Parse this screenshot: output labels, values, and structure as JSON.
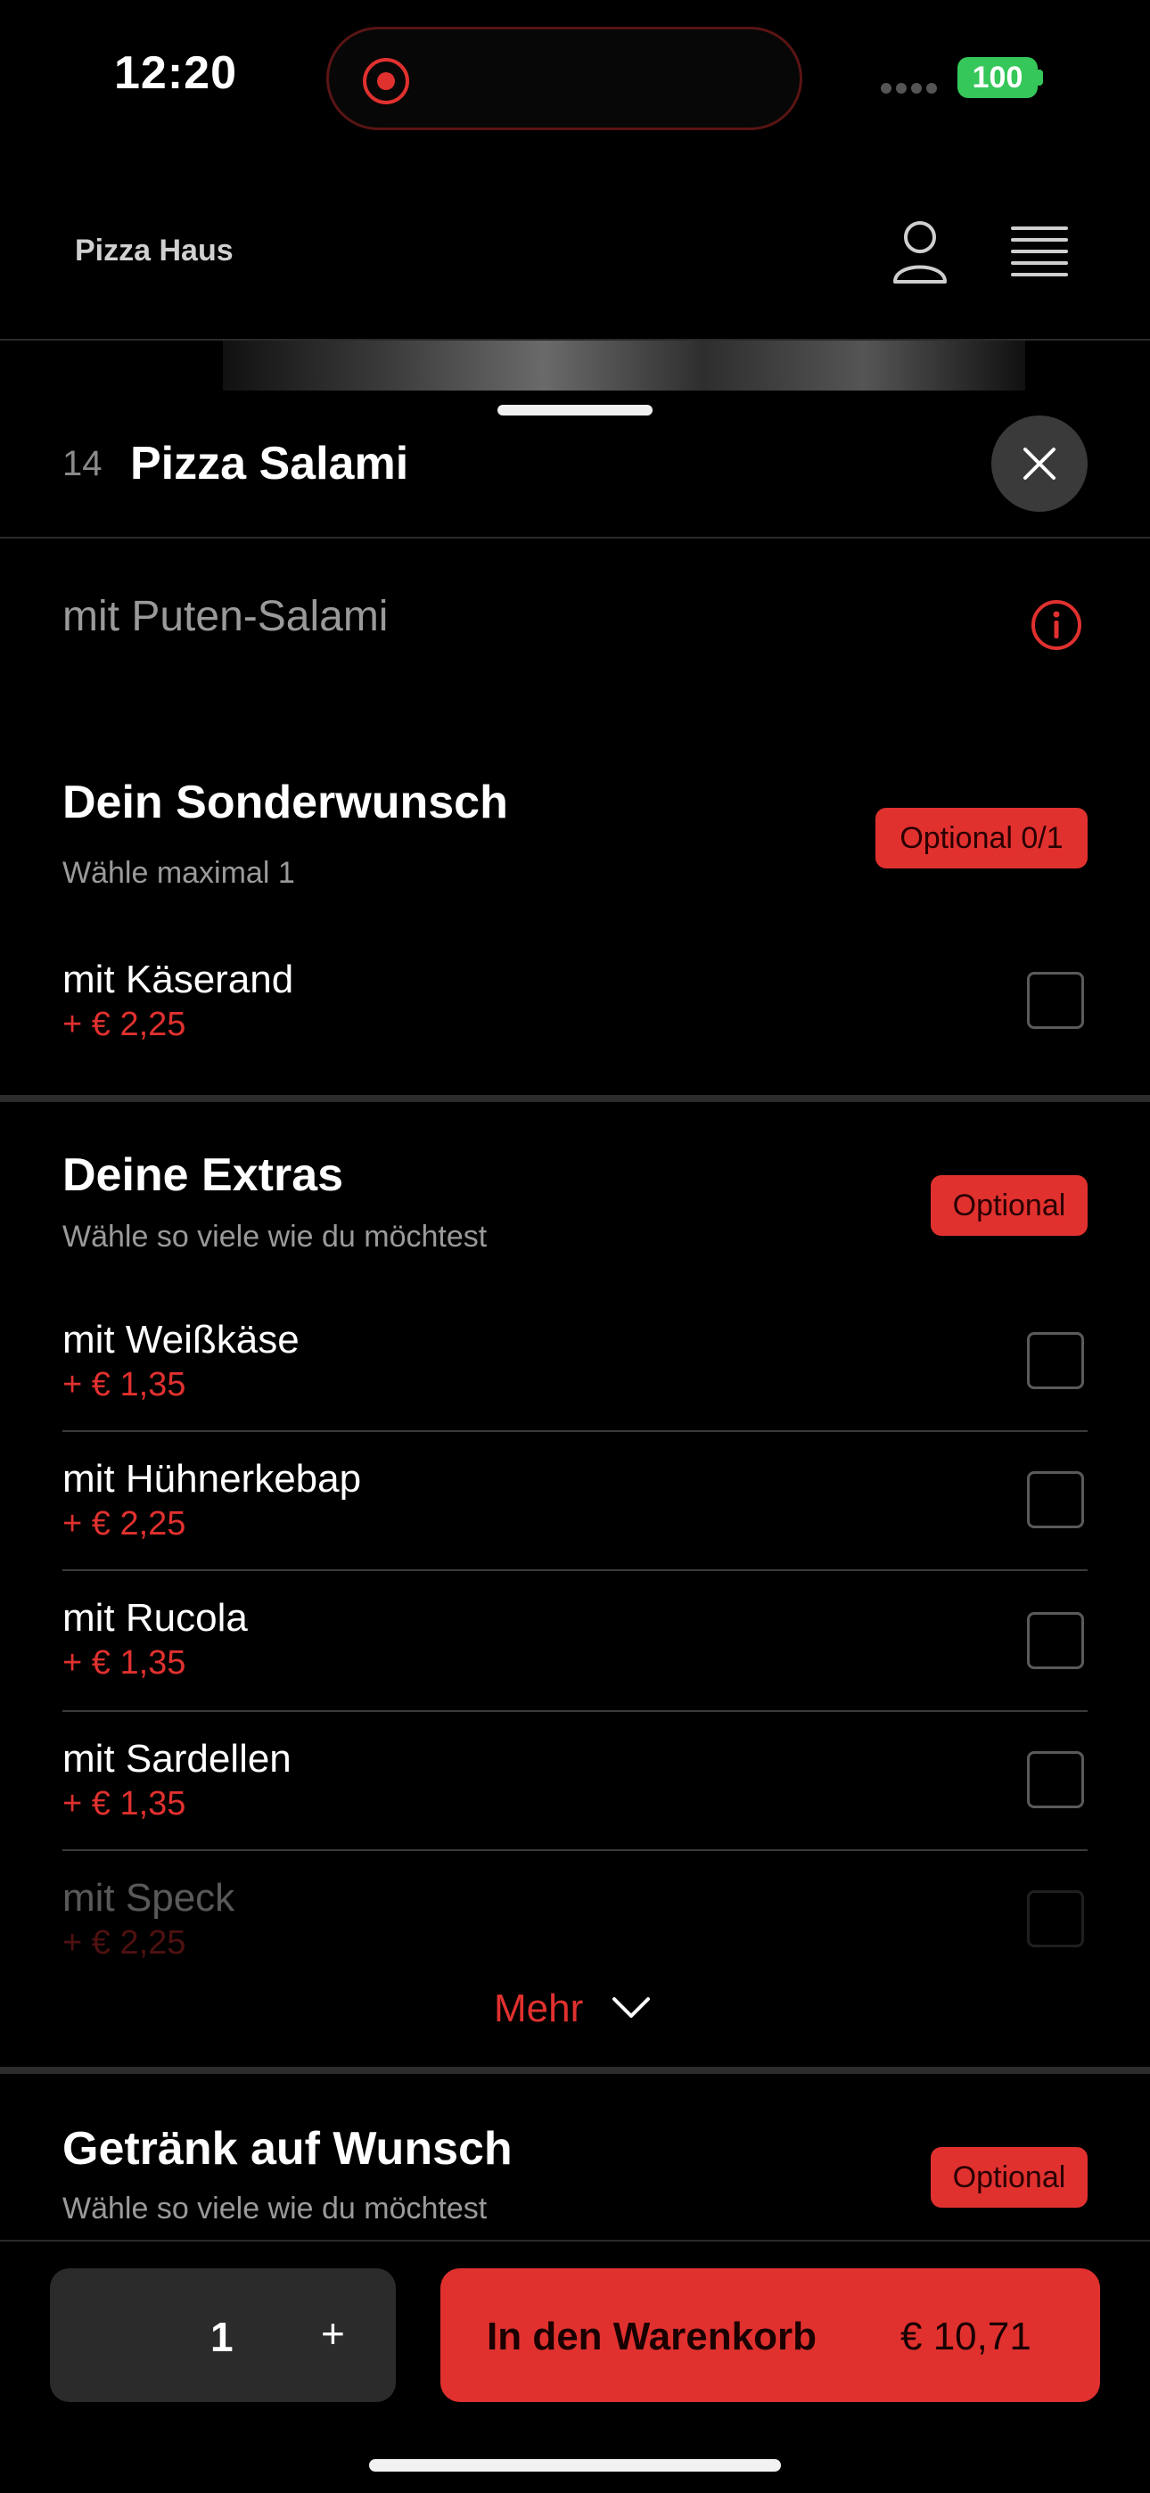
{
  "status_bar": {
    "time": "12:20",
    "battery": "100"
  },
  "header": {
    "brand": "Pizza Haus",
    "user_icon": "user-icon",
    "menu_icon": "hamburger-menu-icon"
  },
  "item": {
    "number": "14",
    "title": "Pizza Salami",
    "description": "mit Puten-Salami"
  },
  "sections": {
    "sonderwunsch": {
      "title": "Dein Sonderwunsch",
      "subtitle": "Wähle maximal 1",
      "badge": "Optional 0/1",
      "options": [
        {
          "name": "mit Käserand",
          "price": "+ € 2,25"
        }
      ]
    },
    "extras": {
      "title": "Deine Extras",
      "subtitle": "Wähle so viele wie du möchtest",
      "badge": "Optional",
      "options": [
        {
          "name": "mit Weißkäse",
          "price": "+ € 1,35"
        },
        {
          "name": "mit Hühnerkebap",
          "price": "+ € 2,25"
        },
        {
          "name": "mit Rucola",
          "price": "+ € 1,35"
        },
        {
          "name": "mit Sardellen",
          "price": "+ € 1,35"
        },
        {
          "name": "mit Speck",
          "price": "+ € 2,25"
        }
      ],
      "more_label": "Mehr"
    },
    "getraenk": {
      "title": "Getränk auf Wunsch",
      "subtitle": "Wähle so viele wie du möchtest",
      "badge": "Optional"
    }
  },
  "bottom_bar": {
    "quantity": "1",
    "plus": "+",
    "cart_label": "In den Warenkorb",
    "cart_price": "€ 10,71"
  },
  "colors": {
    "accent": "#e0312f",
    "background": "#000000",
    "surface": "#2b2b2b"
  }
}
